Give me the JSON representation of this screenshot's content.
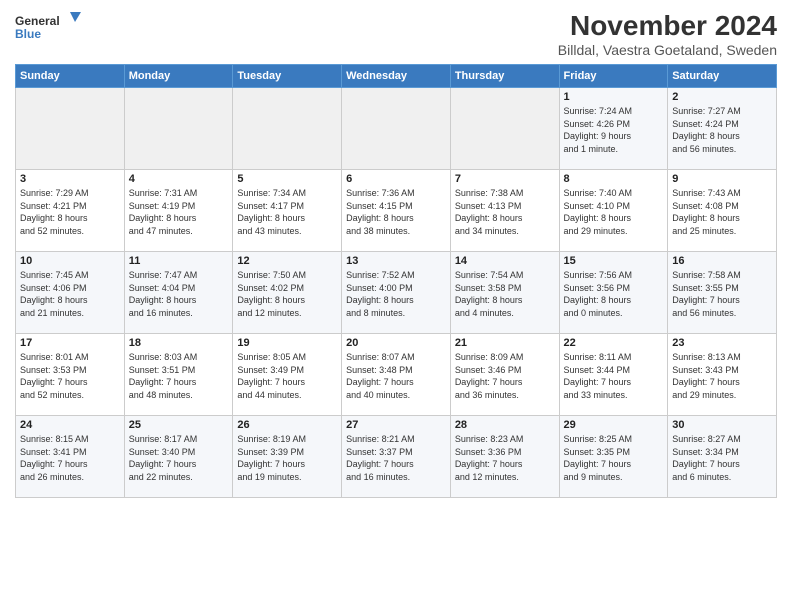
{
  "logo": {
    "line1": "General",
    "line2": "Blue"
  },
  "title": "November 2024",
  "subtitle": "Billdal, Vaestra Goetaland, Sweden",
  "headers": [
    "Sunday",
    "Monday",
    "Tuesday",
    "Wednesday",
    "Thursday",
    "Friday",
    "Saturday"
  ],
  "weeks": [
    [
      {
        "day": "",
        "info": ""
      },
      {
        "day": "",
        "info": ""
      },
      {
        "day": "",
        "info": ""
      },
      {
        "day": "",
        "info": ""
      },
      {
        "day": "",
        "info": ""
      },
      {
        "day": "1",
        "info": "Sunrise: 7:24 AM\nSunset: 4:26 PM\nDaylight: 9 hours\nand 1 minute."
      },
      {
        "day": "2",
        "info": "Sunrise: 7:27 AM\nSunset: 4:24 PM\nDaylight: 8 hours\nand 56 minutes."
      }
    ],
    [
      {
        "day": "3",
        "info": "Sunrise: 7:29 AM\nSunset: 4:21 PM\nDaylight: 8 hours\nand 52 minutes."
      },
      {
        "day": "4",
        "info": "Sunrise: 7:31 AM\nSunset: 4:19 PM\nDaylight: 8 hours\nand 47 minutes."
      },
      {
        "day": "5",
        "info": "Sunrise: 7:34 AM\nSunset: 4:17 PM\nDaylight: 8 hours\nand 43 minutes."
      },
      {
        "day": "6",
        "info": "Sunrise: 7:36 AM\nSunset: 4:15 PM\nDaylight: 8 hours\nand 38 minutes."
      },
      {
        "day": "7",
        "info": "Sunrise: 7:38 AM\nSunset: 4:13 PM\nDaylight: 8 hours\nand 34 minutes."
      },
      {
        "day": "8",
        "info": "Sunrise: 7:40 AM\nSunset: 4:10 PM\nDaylight: 8 hours\nand 29 minutes."
      },
      {
        "day": "9",
        "info": "Sunrise: 7:43 AM\nSunset: 4:08 PM\nDaylight: 8 hours\nand 25 minutes."
      }
    ],
    [
      {
        "day": "10",
        "info": "Sunrise: 7:45 AM\nSunset: 4:06 PM\nDaylight: 8 hours\nand 21 minutes."
      },
      {
        "day": "11",
        "info": "Sunrise: 7:47 AM\nSunset: 4:04 PM\nDaylight: 8 hours\nand 16 minutes."
      },
      {
        "day": "12",
        "info": "Sunrise: 7:50 AM\nSunset: 4:02 PM\nDaylight: 8 hours\nand 12 minutes."
      },
      {
        "day": "13",
        "info": "Sunrise: 7:52 AM\nSunset: 4:00 PM\nDaylight: 8 hours\nand 8 minutes."
      },
      {
        "day": "14",
        "info": "Sunrise: 7:54 AM\nSunset: 3:58 PM\nDaylight: 8 hours\nand 4 minutes."
      },
      {
        "day": "15",
        "info": "Sunrise: 7:56 AM\nSunset: 3:56 PM\nDaylight: 8 hours\nand 0 minutes."
      },
      {
        "day": "16",
        "info": "Sunrise: 7:58 AM\nSunset: 3:55 PM\nDaylight: 7 hours\nand 56 minutes."
      }
    ],
    [
      {
        "day": "17",
        "info": "Sunrise: 8:01 AM\nSunset: 3:53 PM\nDaylight: 7 hours\nand 52 minutes."
      },
      {
        "day": "18",
        "info": "Sunrise: 8:03 AM\nSunset: 3:51 PM\nDaylight: 7 hours\nand 48 minutes."
      },
      {
        "day": "19",
        "info": "Sunrise: 8:05 AM\nSunset: 3:49 PM\nDaylight: 7 hours\nand 44 minutes."
      },
      {
        "day": "20",
        "info": "Sunrise: 8:07 AM\nSunset: 3:48 PM\nDaylight: 7 hours\nand 40 minutes."
      },
      {
        "day": "21",
        "info": "Sunrise: 8:09 AM\nSunset: 3:46 PM\nDaylight: 7 hours\nand 36 minutes."
      },
      {
        "day": "22",
        "info": "Sunrise: 8:11 AM\nSunset: 3:44 PM\nDaylight: 7 hours\nand 33 minutes."
      },
      {
        "day": "23",
        "info": "Sunrise: 8:13 AM\nSunset: 3:43 PM\nDaylight: 7 hours\nand 29 minutes."
      }
    ],
    [
      {
        "day": "24",
        "info": "Sunrise: 8:15 AM\nSunset: 3:41 PM\nDaylight: 7 hours\nand 26 minutes."
      },
      {
        "day": "25",
        "info": "Sunrise: 8:17 AM\nSunset: 3:40 PM\nDaylight: 7 hours\nand 22 minutes."
      },
      {
        "day": "26",
        "info": "Sunrise: 8:19 AM\nSunset: 3:39 PM\nDaylight: 7 hours\nand 19 minutes."
      },
      {
        "day": "27",
        "info": "Sunrise: 8:21 AM\nSunset: 3:37 PM\nDaylight: 7 hours\nand 16 minutes."
      },
      {
        "day": "28",
        "info": "Sunrise: 8:23 AM\nSunset: 3:36 PM\nDaylight: 7 hours\nand 12 minutes."
      },
      {
        "day": "29",
        "info": "Sunrise: 8:25 AM\nSunset: 3:35 PM\nDaylight: 7 hours\nand 9 minutes."
      },
      {
        "day": "30",
        "info": "Sunrise: 8:27 AM\nSunset: 3:34 PM\nDaylight: 7 hours\nand 6 minutes."
      }
    ]
  ]
}
